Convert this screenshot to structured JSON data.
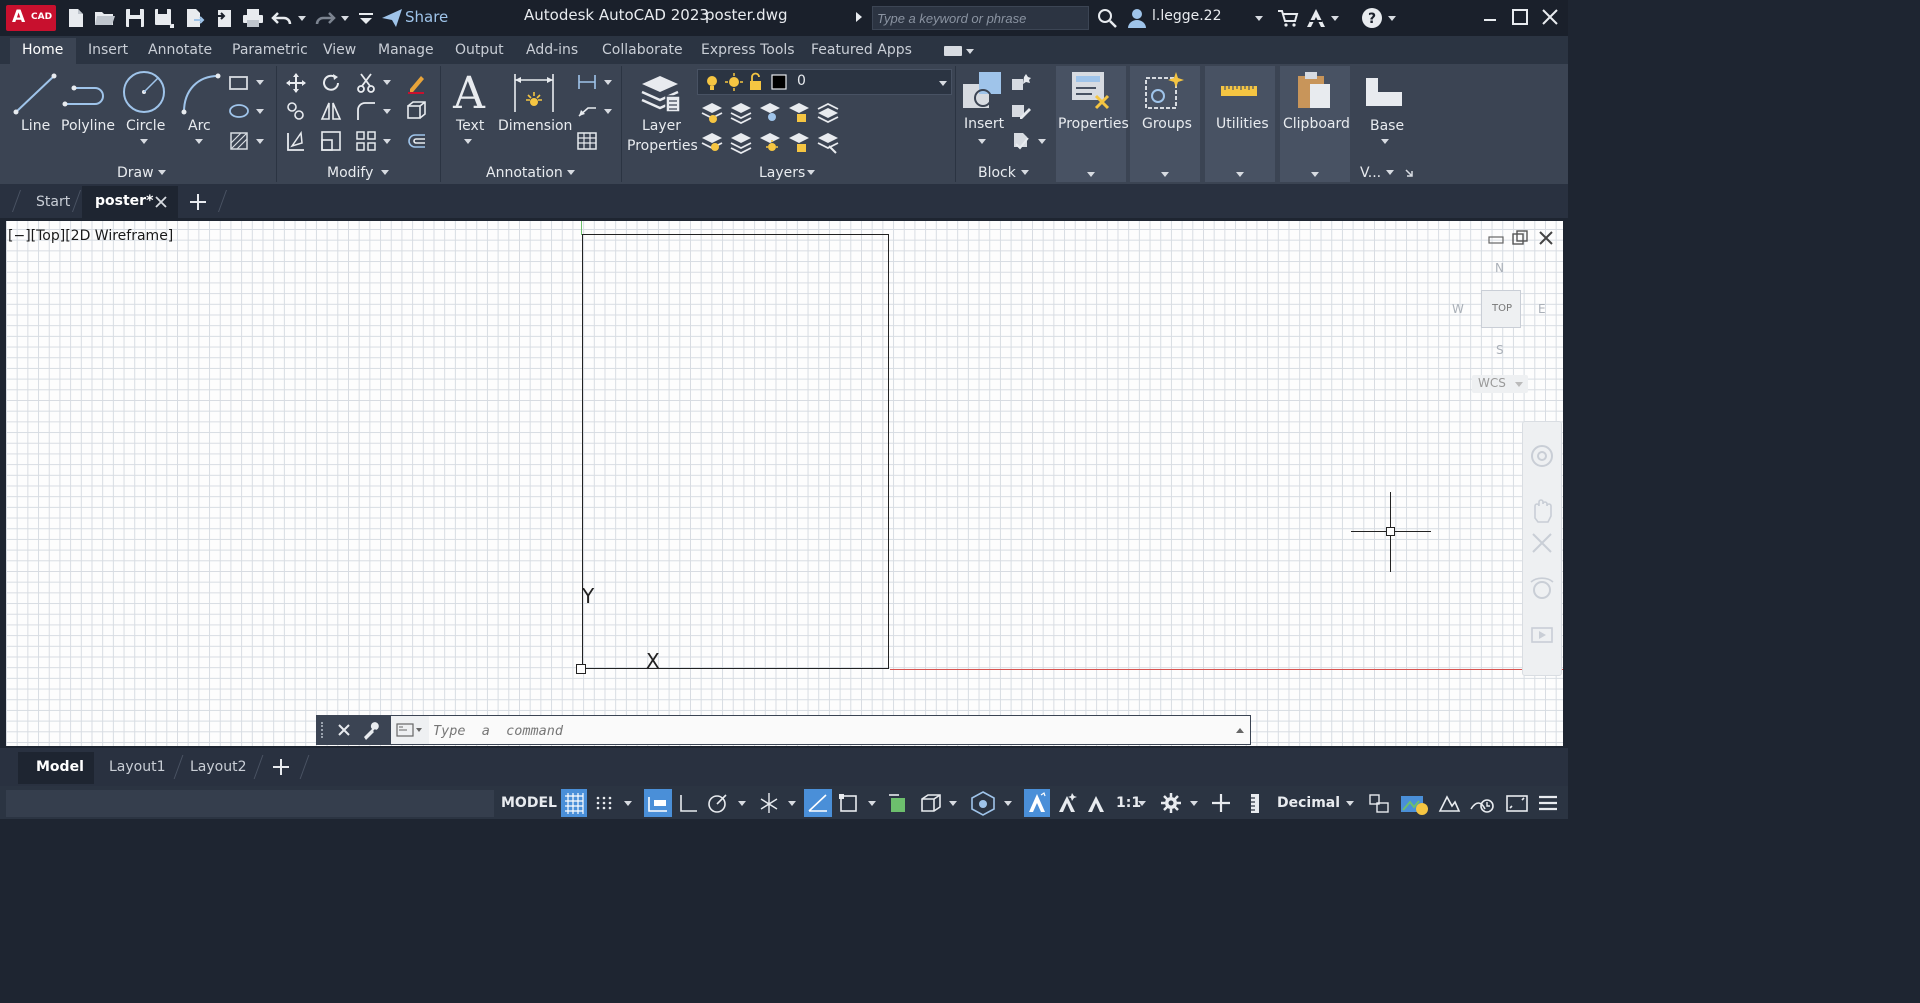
{
  "titlebar": {
    "app_logo_letter": "A",
    "app_logo_text": "CAD",
    "share_label": "Share",
    "app_title": "Autodesk AutoCAD 2023",
    "file_title": "poster.dwg",
    "search_placeholder": "Type a keyword or phrase",
    "user_name": "l.legge.22"
  },
  "ribbon_tabs": [
    "Home",
    "Insert",
    "Annotate",
    "Parametric",
    "View",
    "Manage",
    "Output",
    "Add-ins",
    "Collaborate",
    "Express Tools",
    "Featured Apps"
  ],
  "ribbon": {
    "draw": {
      "line": "Line",
      "polyline": "Polyline",
      "circle": "Circle",
      "arc": "Arc",
      "group": "Draw"
    },
    "modify": {
      "group": "Modify"
    },
    "annotation": {
      "text": "Text",
      "dimension": "Dimension",
      "group": "Annotation"
    },
    "layers": {
      "layer_properties_1": "Layer",
      "layer_properties_2": "Properties",
      "current_layer": "0",
      "group": "Layers"
    },
    "block": {
      "insert": "Insert",
      "group": "Block"
    },
    "properties": "Properties",
    "groups": "Groups",
    "utilities": "Utilities",
    "clipboard": "Clipboard",
    "base": "Base",
    "view_group": "V..."
  },
  "file_tabs": {
    "start": "Start",
    "active": "poster*"
  },
  "viewport": {
    "label": "[−][Top][2D Wireframe]",
    "viewcube_top": "TOP",
    "compass": {
      "n": "N",
      "s": "S",
      "e": "E",
      "w": "W"
    },
    "wcs": "WCS",
    "ucs_x": "X",
    "ucs_y": "Y"
  },
  "command_line": {
    "placeholder": "Type  a  command"
  },
  "layout_tabs": [
    "Model",
    "Layout1",
    "Layout2"
  ],
  "statusbar": {
    "model": "MODEL",
    "scale": "1:1",
    "units": "Decimal"
  },
  "colors": {
    "accent": "#4a8fd8",
    "brand": "#c8102e",
    "canvas": "#fdfdfd"
  }
}
